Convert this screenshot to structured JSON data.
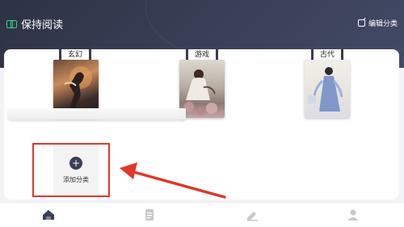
{
  "header": {
    "app_title": "保持阅读",
    "edit_category_label": "编辑分类"
  },
  "categories": [
    {
      "label": "玄幻",
      "cover_icon": "fantasy-cover-image"
    },
    {
      "label": "游戏",
      "cover_icon": "game-cover-image"
    },
    {
      "label": "古代",
      "cover_icon": "ancient-cover-image"
    }
  ],
  "add_category": {
    "label": "添加分类",
    "icon": "plus-icon"
  },
  "annotation": {
    "highlight_color": "#e0372b"
  },
  "nav": {
    "items": [
      {
        "icon": "home-icon",
        "active": true
      },
      {
        "icon": "book-icon",
        "active": false
      },
      {
        "icon": "write-icon",
        "active": false
      },
      {
        "icon": "profile-icon",
        "active": false
      }
    ]
  },
  "colors": {
    "header_bg": "#2e3245",
    "accent_green": "#3ecf8e",
    "nav_active": "#3a3f55",
    "nav_inactive": "#c8c8cc"
  }
}
